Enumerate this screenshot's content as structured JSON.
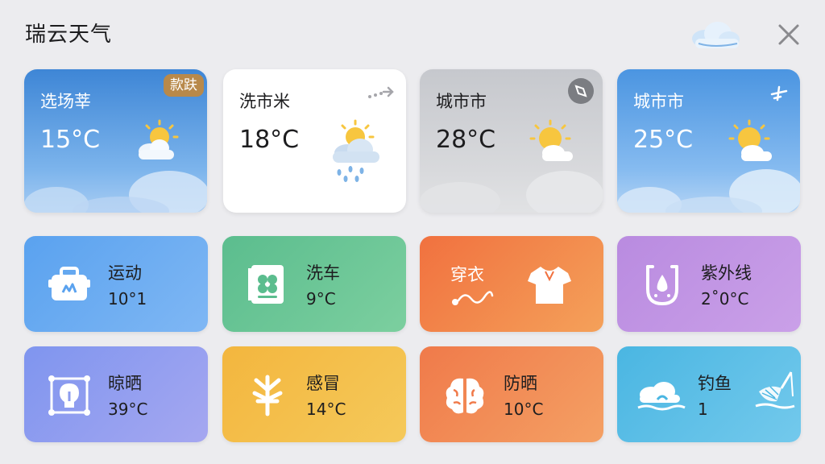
{
  "app": {
    "title": "瑞云天气"
  },
  "cities": [
    {
      "name": "选场莘",
      "temp": "15°C",
      "badge": "款趺",
      "icon": "partly-sunny-icon"
    },
    {
      "name": "洗市米",
      "temp": "18°C",
      "icon": "sun-rain-icon"
    },
    {
      "name": "城市市",
      "temp": "28°C",
      "icon": "partly-sunny-icon"
    },
    {
      "name": "城市市",
      "temp": "25°C",
      "icon": "partly-sunny-icon"
    }
  ],
  "tiles": [
    {
      "label": "运动",
      "value": "10°1",
      "icon": "toolbox-icon"
    },
    {
      "label": "洗车",
      "value": "9°C",
      "icon": "car-wash-icon"
    },
    {
      "label": "穿衣",
      "icon": "tshirt-icon"
    },
    {
      "label": "紫外线",
      "value": "2˚0°C",
      "icon": "uv-drop-icon"
    },
    {
      "label": "晾晒",
      "value": "39°C",
      "icon": "lightbulb-network-icon"
    },
    {
      "label": "感冒",
      "value": "14°C",
      "icon": "wheat-icon"
    },
    {
      "label": "防晒",
      "value": "10°C",
      "icon": "brain-icon"
    },
    {
      "label": "钓鱼",
      "value": "1",
      "icon": "fishing-icon"
    }
  ],
  "colors": {
    "background": "#ececef",
    "sport": "#5aa2ef",
    "carwash": "#5bbd8e",
    "clothes": "#f1713f",
    "uv": "#b98be0",
    "drying": "#7f95ef",
    "cold": "#f3b63e",
    "sunscreen": "#f07a4a",
    "fishing": "#4ab6e2"
  }
}
